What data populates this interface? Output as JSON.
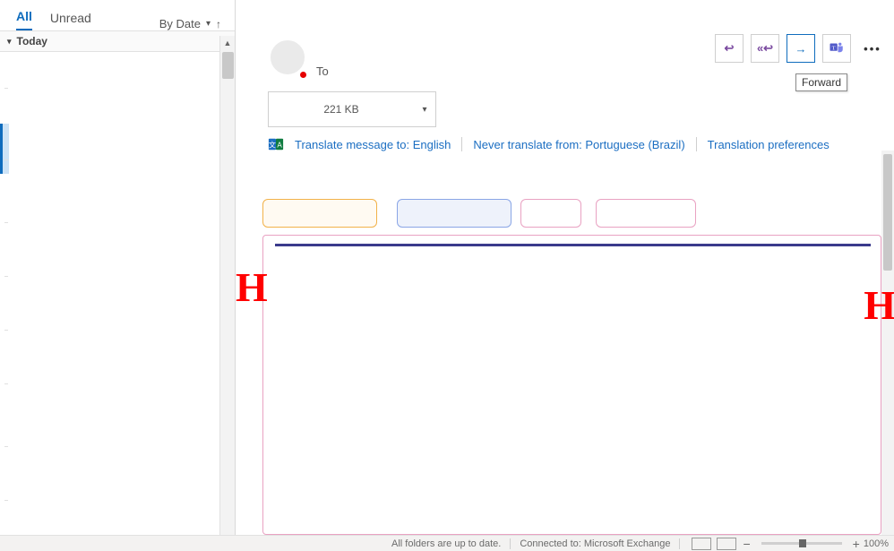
{
  "message_list": {
    "tabs": {
      "all": "All",
      "unread": "Unread"
    },
    "sort_label": "By Date",
    "group_header": "Today"
  },
  "message": {
    "to_label": "To",
    "attachment": {
      "size": "221 KB"
    },
    "translate": {
      "translate_to": "Translate message to: English",
      "never_translate": "Never translate from: Portuguese (Brazil)",
      "preferences": "Translation preferences"
    },
    "tooltip_forward": "Forward"
  },
  "status": {
    "folders": "All folders are up to date.",
    "connection": "Connected to: Microsoft Exchange",
    "zoom": "100%"
  }
}
